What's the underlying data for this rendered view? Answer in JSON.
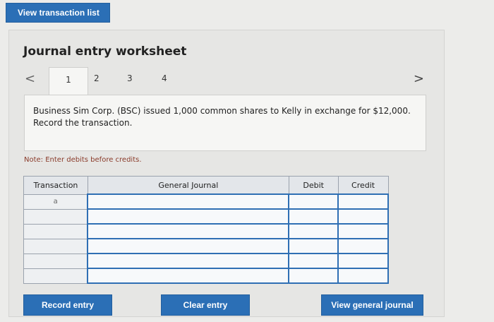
{
  "top_button": "View transaction list",
  "worksheet": {
    "title": "Journal entry worksheet",
    "tabs": [
      "1",
      "2",
      "3",
      "4"
    ],
    "prev": "<",
    "next": ">"
  },
  "question": "Business Sim Corp. (BSC) issued 1,000 common shares to Kelly in exchange for $12,000. Record the transaction.",
  "note": "Note: Enter debits before credits.",
  "table": {
    "headers": [
      "Transaction",
      "General Journal",
      "Debit",
      "Credit"
    ],
    "first_transaction": "a"
  },
  "buttons": {
    "record": "Record entry",
    "clear": "Clear entry",
    "view_general": "View general journal"
  }
}
